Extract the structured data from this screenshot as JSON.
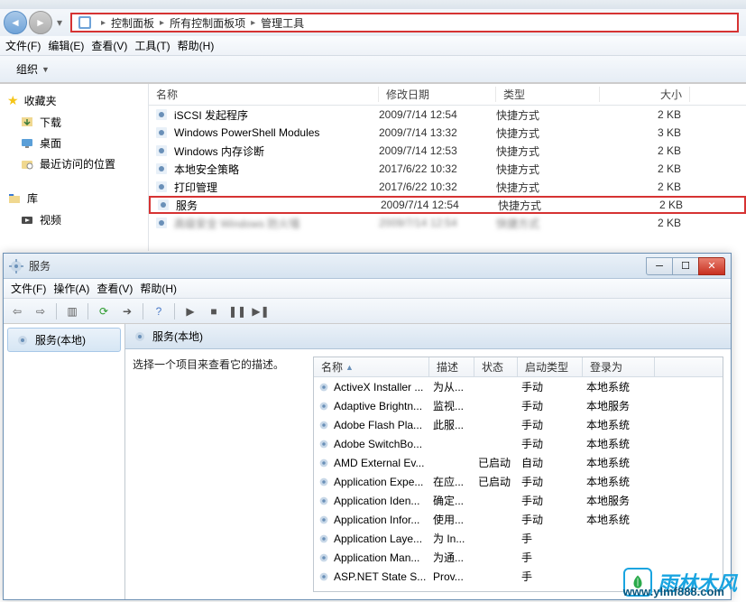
{
  "breadcrumb": {
    "items": [
      "控制面板",
      "所有控制面板项",
      "管理工具"
    ]
  },
  "menu": {
    "file": "文件(F)",
    "edit": "编辑(E)",
    "view": "查看(V)",
    "tools": "工具(T)",
    "help": "帮助(H)"
  },
  "toolbar": {
    "organize": "组织"
  },
  "sidebar": {
    "favorites": "收藏夹",
    "downloads": "下载",
    "desktop": "桌面",
    "recent": "最近访问的位置",
    "library": "库",
    "video": "视频"
  },
  "columns": {
    "name": "名称",
    "date": "修改日期",
    "type": "类型",
    "size": "大小"
  },
  "files": [
    {
      "name": "iSCSI 发起程序",
      "date": "2009/7/14 12:54",
      "type": "快捷方式",
      "size": "2 KB"
    },
    {
      "name": "Windows PowerShell Modules",
      "date": "2009/7/14 13:32",
      "type": "快捷方式",
      "size": "3 KB"
    },
    {
      "name": "Windows 内存诊断",
      "date": "2009/7/14 12:53",
      "type": "快捷方式",
      "size": "2 KB"
    },
    {
      "name": "本地安全策略",
      "date": "2017/6/22 10:32",
      "type": "快捷方式",
      "size": "2 KB"
    },
    {
      "name": "打印管理",
      "date": "2017/6/22 10:32",
      "type": "快捷方式",
      "size": "2 KB"
    },
    {
      "name": "服务",
      "date": "2009/7/14 12:54",
      "type": "快捷方式",
      "size": "2 KB"
    },
    {
      "name": "高级安全 Windows 防火墙",
      "date": "2009/7/14 12:54",
      "type": "快捷方式",
      "size": "2 KB"
    }
  ],
  "services_window": {
    "title": "服务",
    "menu": {
      "file": "文件(F)",
      "action": "操作(A)",
      "view": "查看(V)",
      "help": "帮助(H)"
    },
    "left_panel": "服务(本地)",
    "main_header": "服务(本地)",
    "description_prompt": "选择一个项目来查看它的描述。",
    "columns": {
      "name": "名称",
      "desc": "描述",
      "status": "状态",
      "startup": "启动类型",
      "logon": "登录为"
    },
    "rows": [
      {
        "name": "ActiveX Installer ...",
        "desc": "为从...",
        "status": "",
        "startup": "手动",
        "logon": "本地系统"
      },
      {
        "name": "Adaptive Brightn...",
        "desc": "监视...",
        "status": "",
        "startup": "手动",
        "logon": "本地服务"
      },
      {
        "name": "Adobe Flash Pla...",
        "desc": "此服...",
        "status": "",
        "startup": "手动",
        "logon": "本地系统"
      },
      {
        "name": "Adobe SwitchBo...",
        "desc": "",
        "status": "",
        "startup": "手动",
        "logon": "本地系统"
      },
      {
        "name": "AMD External Ev...",
        "desc": "",
        "status": "已启动",
        "startup": "自动",
        "logon": "本地系统"
      },
      {
        "name": "Application Expe...",
        "desc": "在应...",
        "status": "已启动",
        "startup": "手动",
        "logon": "本地系统"
      },
      {
        "name": "Application Iden...",
        "desc": "确定...",
        "status": "",
        "startup": "手动",
        "logon": "本地服务"
      },
      {
        "name": "Application Infor...",
        "desc": "使用...",
        "status": "",
        "startup": "手动",
        "logon": "本地系统"
      },
      {
        "name": "Application Laye...",
        "desc": "为 In...",
        "status": "",
        "startup": "手",
        "logon": ""
      },
      {
        "name": "Application Man...",
        "desc": "为通...",
        "status": "",
        "startup": "手",
        "logon": ""
      },
      {
        "name": "ASP.NET State S...",
        "desc": "Prov...",
        "status": "",
        "startup": "手",
        "logon": ""
      }
    ]
  },
  "watermark": {
    "text": "雨林木风",
    "url": "www.ylmf888.com"
  }
}
